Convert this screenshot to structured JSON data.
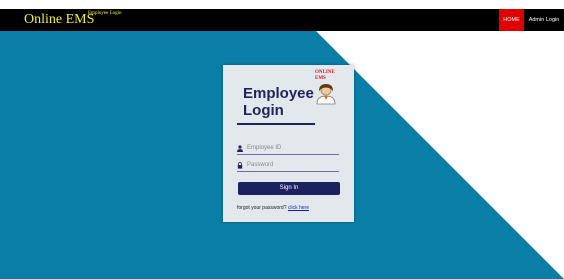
{
  "header": {
    "brand": "Online EMS",
    "subtitle": "Employee Login",
    "nav": {
      "home": "HOME",
      "admin": "Admin Login"
    }
  },
  "login_card": {
    "title_line1": "Employee",
    "title_line2": "Login",
    "logo_line1": "ONLINE",
    "logo_line2": "EMS",
    "employee_id_placeholder": "Employee ID",
    "password_placeholder": "Password",
    "sign_in": "Sign In",
    "forgot_text": "forgot your password?",
    "forgot_link": "click here"
  },
  "colors": {
    "background_blue": "#0a7ea6",
    "topbar": "#000000",
    "brand_yellow": "#f5f021",
    "home_red": "#e00000",
    "card_bg": "#e3e8ed",
    "navy": "#22245e",
    "button": "#1c2160"
  },
  "icons": {
    "employee_id": "user-icon",
    "password": "lock-icon",
    "logo": "employee-avatar-icon"
  }
}
